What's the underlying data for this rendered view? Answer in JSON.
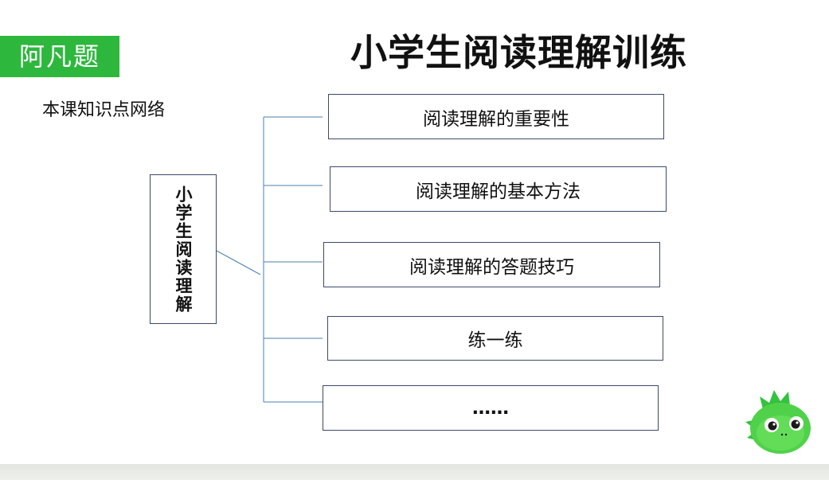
{
  "brand": {
    "badge_label": "阿凡题",
    "badge_color": "#2db83d"
  },
  "title": "小学生阅读理解训练",
  "subtitle": "本课知识点网络",
  "mind_map": {
    "root": "小学生阅读理解",
    "branches": [
      {
        "label": "阅读理解的重要性"
      },
      {
        "label": "阅读理解的基本方法"
      },
      {
        "label": "阅读理解的答题技巧"
      },
      {
        "label": "练一练"
      },
      {
        "label": "……"
      }
    ],
    "line_color": "#4a7fb0",
    "box_border_color": "#3b4a6b"
  },
  "mascot": {
    "icon": "green-dinosaur-mascot-icon"
  }
}
